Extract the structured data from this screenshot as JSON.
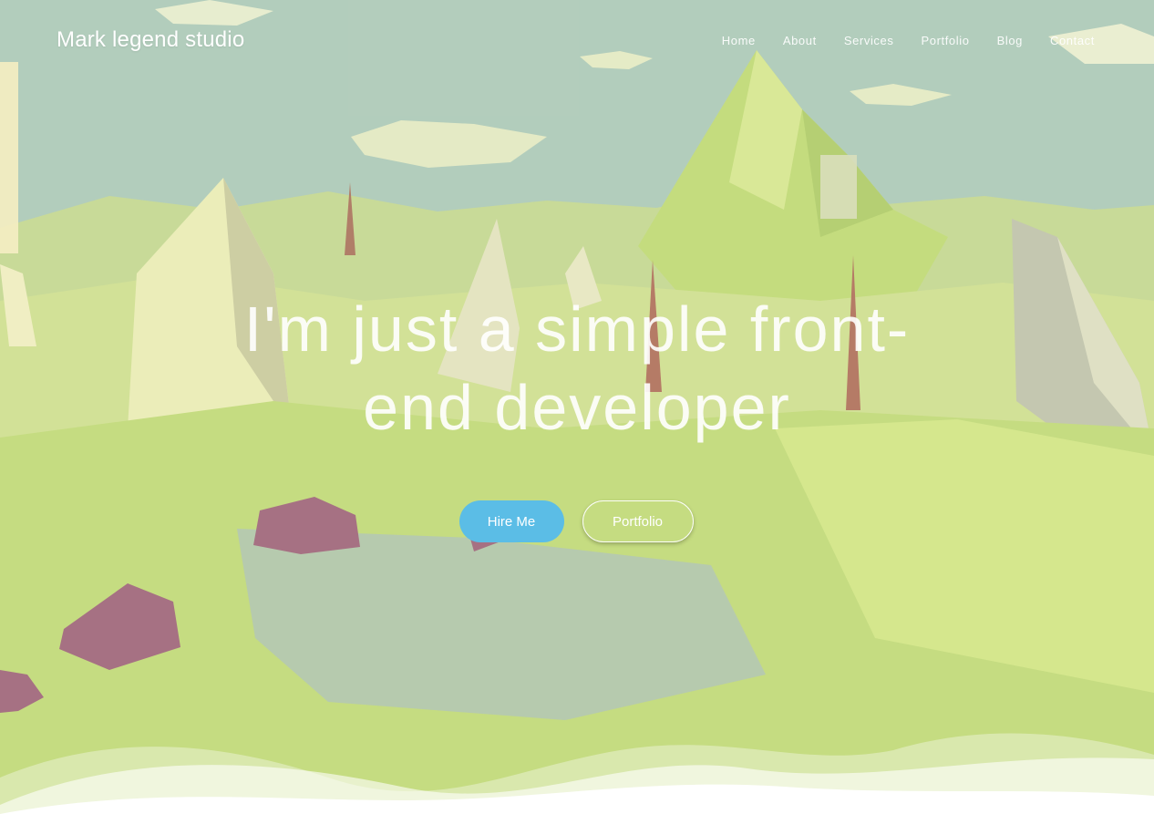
{
  "brand": {
    "name": "Mark legend studio"
  },
  "nav": {
    "items": [
      {
        "label": "Home"
      },
      {
        "label": "About"
      },
      {
        "label": "Services"
      },
      {
        "label": "Portfolio"
      },
      {
        "label": "Blog"
      },
      {
        "label": "Contact"
      }
    ]
  },
  "hero": {
    "headline_line1": "I'm just a simple front-",
    "headline_line2": "end developer",
    "primary_button": "Hire Me",
    "secondary_button": "Portfolio"
  },
  "colors": {
    "primary_button": "#5bbde6",
    "text": "#ffffff",
    "background_page": "#ffffff"
  }
}
